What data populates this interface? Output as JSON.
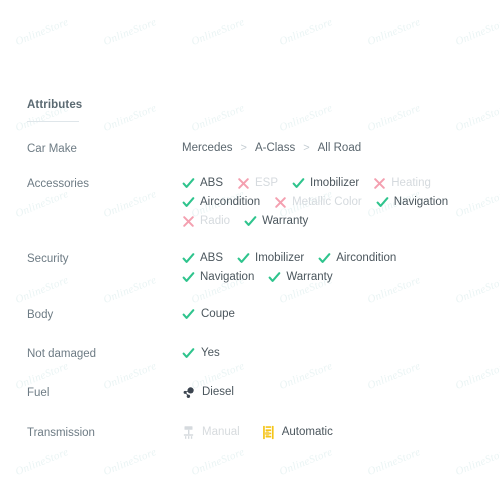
{
  "colors": {
    "check_green": "#2fc48d",
    "cross_pink": "#f4a0b0",
    "label_gray": "#6d7b84",
    "value_gray": "#4b565d",
    "disabled_gray": "#d5dade",
    "automatic_yellow": "#f5c518",
    "manual_gray": "#d5dade",
    "fuel_dark": "#3c4550",
    "rule_gray": "#dfe6ea"
  },
  "watermark": {
    "text": "OnlineStore",
    "repeat_cols": 6,
    "repeat_rows": 6
  },
  "section": {
    "title": "Attributes"
  },
  "rows": [
    {
      "label": "Car Make",
      "type": "breadcrumb",
      "separator": ">",
      "crumbs": [
        "Mercedes",
        "A-Class",
        "All Road"
      ]
    },
    {
      "label": "Accessories",
      "type": "options",
      "options": [
        {
          "label": "ABS",
          "state": "on"
        },
        {
          "label": "ESP",
          "state": "off"
        },
        {
          "label": "Imobilizer",
          "state": "on"
        },
        {
          "label": "Heating",
          "state": "off"
        },
        {
          "label": "Aircondition",
          "state": "on"
        },
        {
          "label": "Metallic Color",
          "state": "off"
        },
        {
          "label": "Navigation",
          "state": "on"
        },
        {
          "label": "Radio",
          "state": "off"
        },
        {
          "label": "Warranty",
          "state": "on"
        }
      ]
    },
    {
      "label": "Security",
      "type": "options",
      "options": [
        {
          "label": "ABS",
          "state": "on"
        },
        {
          "label": "Imobilizer",
          "state": "on"
        },
        {
          "label": "Aircondition",
          "state": "on"
        },
        {
          "label": "Navigation",
          "state": "on"
        },
        {
          "label": "Warranty",
          "state": "on"
        }
      ]
    },
    {
      "label": "Body",
      "type": "single",
      "icon": "check-icon",
      "value": "Coupe"
    },
    {
      "label": "Not damaged",
      "type": "single",
      "icon": "check-icon",
      "value": "Yes"
    },
    {
      "label": "Fuel",
      "type": "fuel",
      "icon": "fuel-molecule-icon",
      "value": "Diesel"
    },
    {
      "label": "Transmission",
      "type": "transmission",
      "items": [
        {
          "label": "Manual",
          "state": "off",
          "icon": "manual-gearstick-icon"
        },
        {
          "label": "Automatic",
          "state": "on",
          "icon": "automatic-gearstick-icon"
        }
      ]
    }
  ]
}
